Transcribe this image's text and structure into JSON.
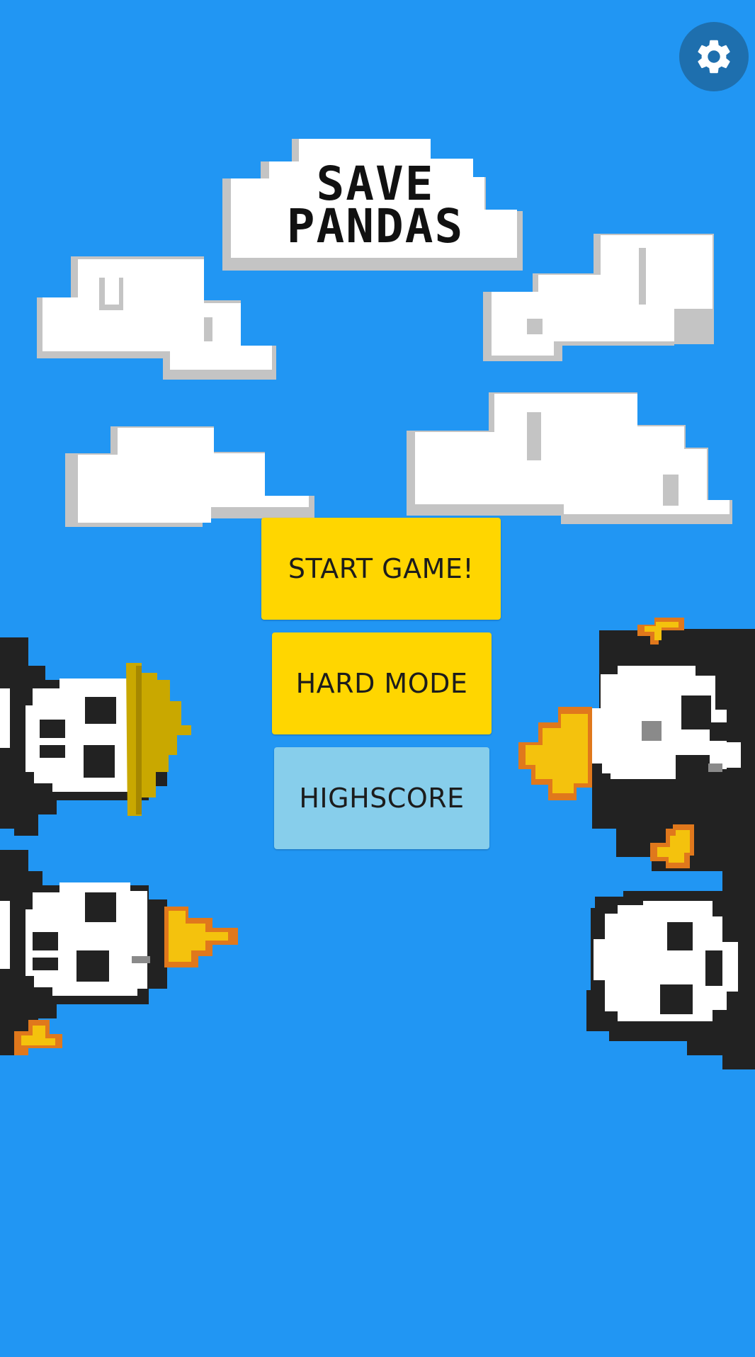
{
  "title": {
    "line1": "SAVE",
    "line2": "PANDAS"
  },
  "settings": {
    "icon": "gear-icon"
  },
  "buttons": {
    "start": "START GAME!",
    "hard": "HARD MODE",
    "highscore": "HIGHSCORE"
  },
  "colors": {
    "sky": "#2196F3",
    "button_primary": "#FFD600",
    "button_secondary": "#87CEEB",
    "settings_bg": "#1E6FAE",
    "cloud": "#FFFFFF",
    "cloud_shadow": "#C4C4C4"
  }
}
